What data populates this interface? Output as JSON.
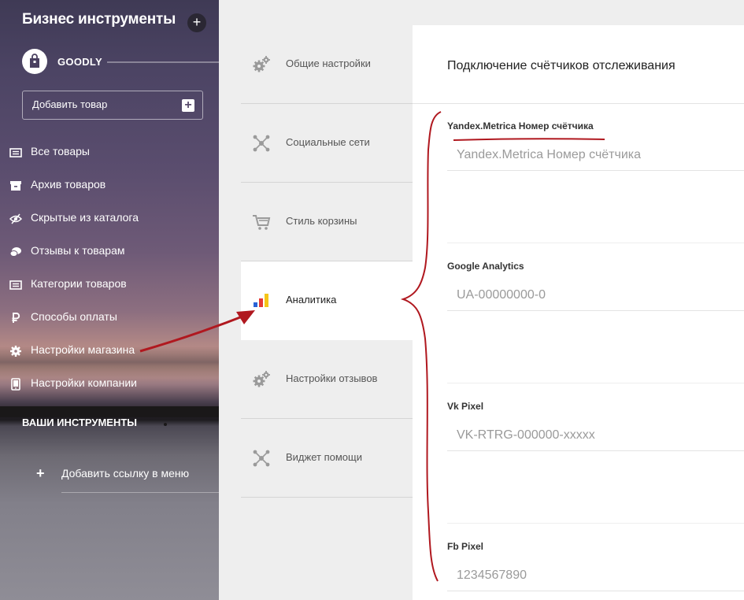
{
  "sidebar": {
    "title": "Бизнес инструменты",
    "add_icon": "plus-icon",
    "shop_name": "GOODLY",
    "add_product_label": "Добавить товар",
    "nav": [
      {
        "label": "Все товары",
        "icon": "list-icon"
      },
      {
        "label": "Архив товаров",
        "icon": "archive-icon"
      },
      {
        "label": "Скрытые из каталога",
        "icon": "eye-off-icon"
      },
      {
        "label": "Отзывы к товарам",
        "icon": "chat-icon"
      },
      {
        "label": "Категории товаров",
        "icon": "categories-icon"
      },
      {
        "label": "Способы оплаты",
        "icon": "ruble-icon"
      },
      {
        "label": "Настройки магазина",
        "icon": "gear-icon"
      },
      {
        "label": "Настройки компании",
        "icon": "tablet-icon"
      }
    ],
    "tools_title": "ВАШИ ИНСТРУМЕНТЫ",
    "add_link_label": "Добавить ссылку в меню"
  },
  "tabs": [
    {
      "label": "Общие настройки",
      "icon": "gears-icon",
      "active": false
    },
    {
      "label": "Социальные сети",
      "icon": "network-icon",
      "active": false
    },
    {
      "label": "Стиль корзины",
      "icon": "cart-icon",
      "active": false
    },
    {
      "label": "Аналитика",
      "icon": "bar-chart-icon",
      "active": true
    },
    {
      "label": "Настройки отзывов",
      "icon": "gears-icon",
      "active": false
    },
    {
      "label": "Виджет помощи",
      "icon": "network-icon",
      "active": false
    }
  ],
  "panel": {
    "title": "Подключение счётчиков отслеживания",
    "fields": [
      {
        "label": "Yandex.Metrica Номер счётчика",
        "placeholder": "Yandex.Metrica Номер счётчика",
        "value": ""
      },
      {
        "label": "Google Analytics",
        "placeholder": "UA-00000000-0",
        "value": ""
      },
      {
        "label": "Vk Pixel",
        "placeholder": "VK-RTRG-000000-xxxxx",
        "value": ""
      },
      {
        "label": "Fb Pixel",
        "placeholder": "1234567890",
        "value": ""
      }
    ]
  },
  "colors": {
    "annotation": "#b0181f",
    "analytics_bars": [
      "#2a63d6",
      "#e53935",
      "#f5c518"
    ]
  }
}
